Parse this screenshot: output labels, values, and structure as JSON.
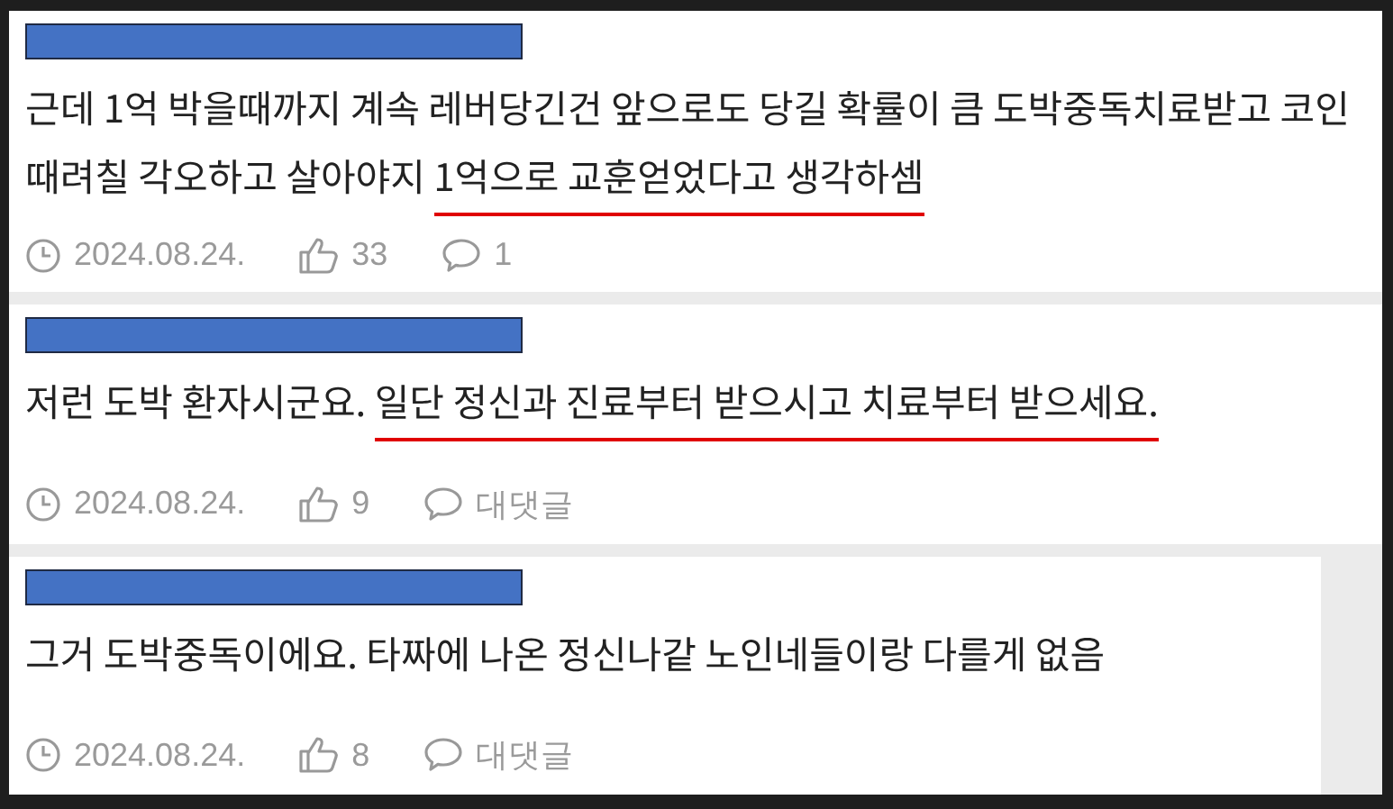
{
  "comments": [
    {
      "author": {
        "redacted": true
      },
      "full_width": true,
      "body": [
        {
          "text": "근데 1억 박을때까지 계속 레버당긴건 앞으로도 당길 확률이 큼 도박중독치료받고 코인 때려칠 각오하고 살아야지 ",
          "underlined": false
        },
        {
          "text": "1억으로 교훈얻었다고 생각하셈",
          "underlined": true
        }
      ],
      "date": "2024.08.24.",
      "likes": "33",
      "reply": "1"
    },
    {
      "author": {
        "redacted": true
      },
      "full_width": true,
      "body": [
        {
          "text": "저런 도박 환자시군요. ",
          "underlined": false
        },
        {
          "text": "일단 정신과 진료부터 받으시고 치료부터 받으세요.",
          "underlined": true
        }
      ],
      "date": "2024.08.24.",
      "likes": "9",
      "reply": "대댓글"
    },
    {
      "author": {
        "redacted": true
      },
      "full_width": false,
      "body": [
        {
          "text": "그거 도박중독이에요. 타짜에 나온 정신나같 노인네들이랑 다를게 없음",
          "underlined": false
        }
      ],
      "date": "2024.08.24.",
      "likes": "8",
      "reply": "대댓글"
    }
  ]
}
